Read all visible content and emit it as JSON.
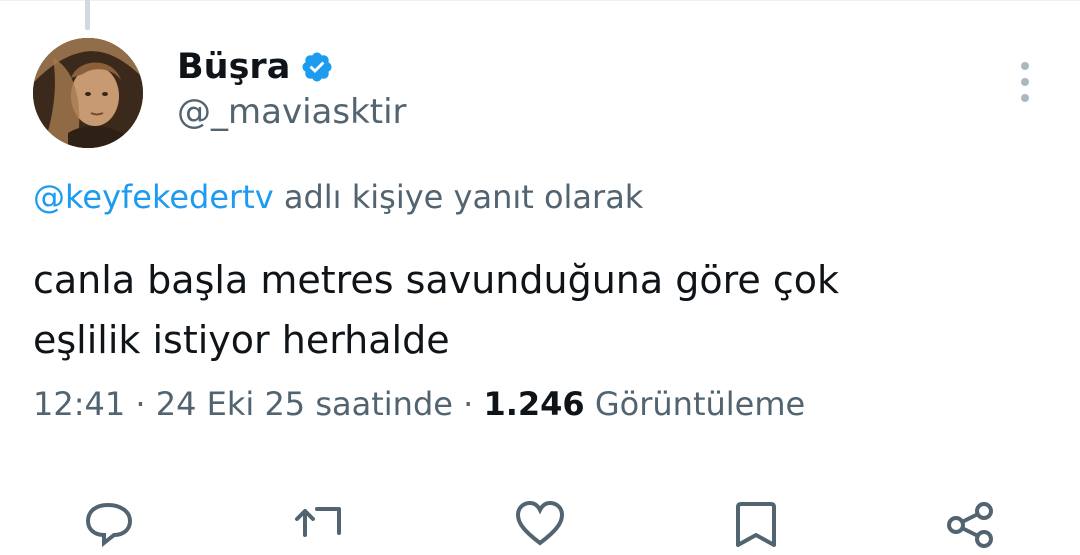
{
  "author": {
    "display_name": "Büşra",
    "handle": "@_maviasktir"
  },
  "reply_context": {
    "mention": "@keyfekedertv",
    "suffix": " adlı kişiye yanıt olarak"
  },
  "tweet": {
    "text_line1": "canla başla metres savunduğuna göre çok",
    "text_line2": "eşlilik istiyor herhalde"
  },
  "meta": {
    "time": "12:41",
    "separator1": " · ",
    "date": "24 Eki 25 saatinde",
    "separator2": " · ",
    "views_count": "1.246",
    "views_label": " Görüntüleme"
  },
  "colors": {
    "accent": "#1d9bf0",
    "secondary_text": "#536471",
    "primary_text": "#0f1419"
  },
  "icons": {
    "verified": "verified-badge-icon",
    "more": "more-vertical-icon",
    "reply": "reply-icon",
    "retweet": "retweet-icon",
    "like": "heart-icon",
    "bookmark": "bookmark-icon",
    "share": "share-icon"
  }
}
